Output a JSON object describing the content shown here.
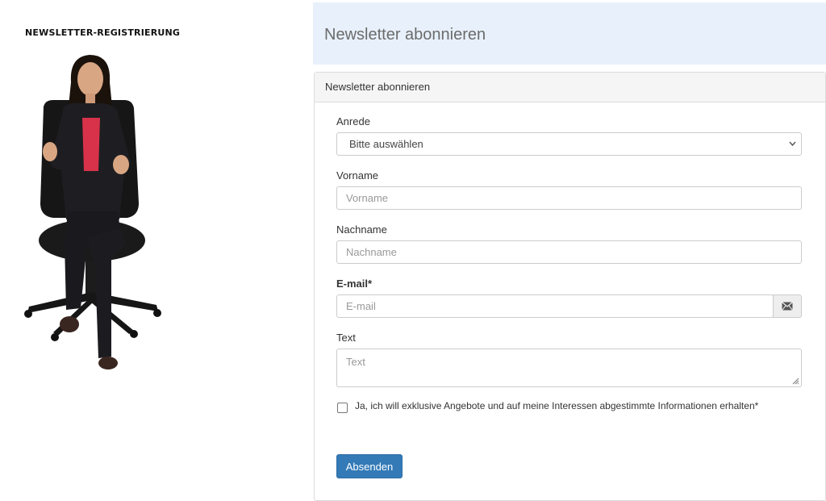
{
  "sidebar": {
    "title": "NEWSLETTER-REGISTRIERUNG"
  },
  "header": {
    "title": "Newsletter abonnieren"
  },
  "panel": {
    "heading": "Newsletter abonnieren",
    "anrede": {
      "label": "Anrede",
      "value": "Bitte auswählen"
    },
    "vorname": {
      "label": "Vorname",
      "placeholder": "Vorname"
    },
    "nachname": {
      "label": "Nachname",
      "placeholder": "Nachname"
    },
    "email": {
      "label": "E-mail*",
      "placeholder": "E-mail",
      "icon": "envelope-icon"
    },
    "text": {
      "label": "Text",
      "placeholder": "Text"
    },
    "consent": {
      "label": "Ja, ich will exklusive Angebote und auf meine Interessen abgestimmte Informationen erhalten*",
      "checked": false
    },
    "submit_label": "Absenden"
  },
  "colors": {
    "header_band": "#e8f1fb",
    "button": "#337ab7"
  }
}
